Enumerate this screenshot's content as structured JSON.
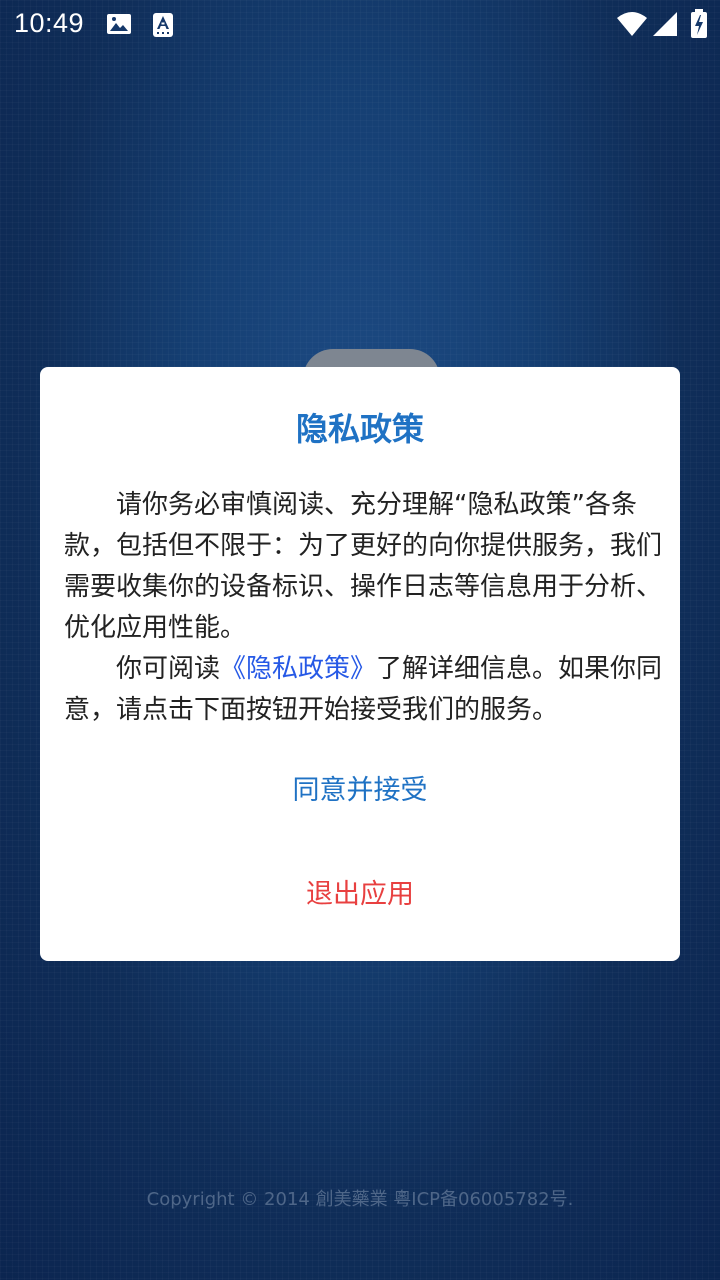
{
  "status_bar": {
    "time": "10:49",
    "icons": [
      "image-icon",
      "keyboard-a-icon",
      "wifi-icon",
      "signal-icon",
      "battery-charging-icon"
    ]
  },
  "dialog": {
    "title": "隐私政策",
    "paragraph1": "请你务必审慎阅读、充分理解“隐私政策”各条款，包括但不限于：为了更好的向你提供服务，我们需要收集你的设备标识、操作日志等信息用于分析、优化应用性能。",
    "paragraph2_prefix": "你可阅读",
    "policy_link": "《隐私政策》",
    "paragraph2_suffix": "了解详细信息。如果你同意，请点击下面按钮开始接受我们的服务。",
    "agree_label": "同意并接受",
    "exit_label": "退出应用"
  },
  "footer": {
    "copyright": "Copyright © 2014 創美藥業 粵ICP备06005782号."
  },
  "colors": {
    "accent": "#1f72c4",
    "link": "#2659e6",
    "danger": "#e84040",
    "background": "#0f2d58"
  }
}
